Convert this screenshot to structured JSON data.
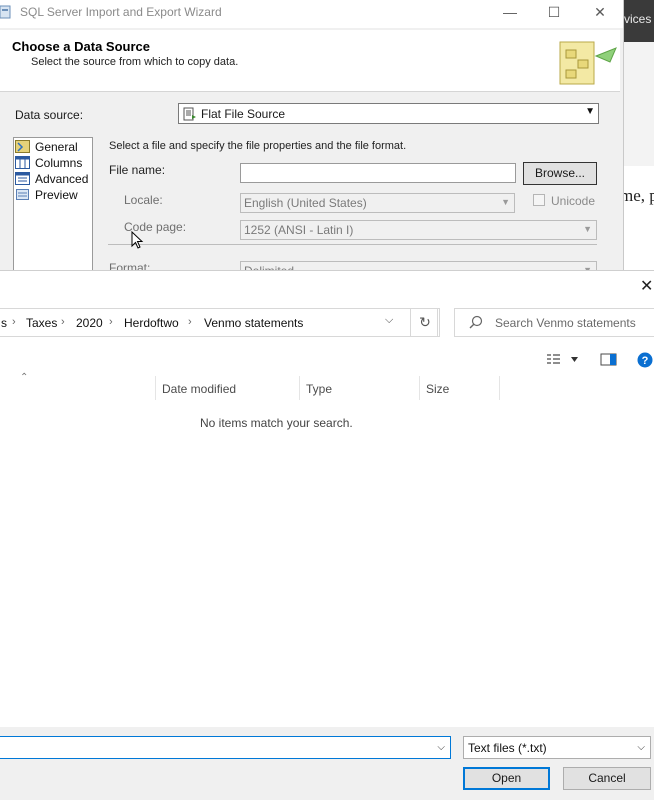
{
  "background_app": {
    "tab_fragment": "vices",
    "text_fragment": "me, p"
  },
  "wizard": {
    "title": "SQL Server Import and Export Wizard",
    "header_title": "Choose a Data Source",
    "header_subtitle": "Select the source from which to copy data.",
    "data_source_label": "Data source:",
    "data_source_value": "Flat File Source",
    "nav_items": [
      "General",
      "Columns",
      "Advanced",
      "Preview"
    ],
    "description": "Select a file and specify the file properties and the file format.",
    "file_name_label": "File name:",
    "file_name_value": "",
    "browse_label": "Browse...",
    "locale_label": "Locale:",
    "locale_value": "English (United States)",
    "unicode_label": "Unicode",
    "code_page_label": "Code page:",
    "code_page_value": "1252  (ANSI - Latin I)",
    "format_label": "Format:",
    "format_value": "Delimited"
  },
  "dialog": {
    "breadcrumbs": [
      "s",
      "Taxes",
      "2020",
      "Herdoftwo",
      "Venmo statements"
    ],
    "search_placeholder": "Search Venmo statements",
    "columns": [
      "Date modified",
      "Type",
      "Size"
    ],
    "empty_message": "No items match your search.",
    "file_type": "Text files (*.txt)",
    "open_label": "Open",
    "cancel_label": "Cancel"
  },
  "colors": {
    "accent": "#0078d7",
    "help": "#0a6fd1"
  }
}
